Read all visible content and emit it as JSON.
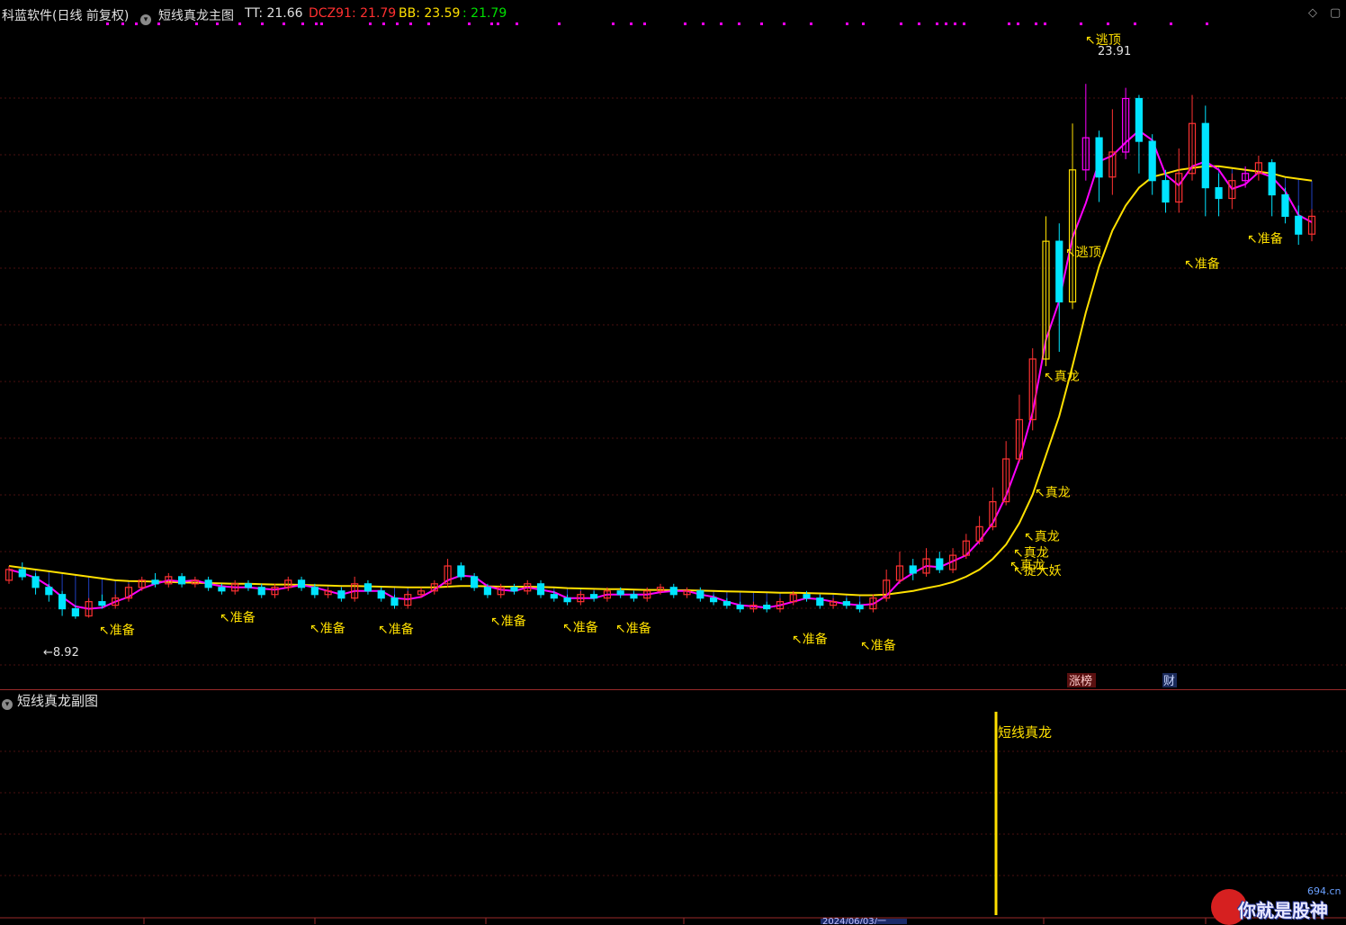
{
  "header": {
    "title": "科蓝软件(日线 前复权)",
    "indicator_name": "短线真龙主图",
    "tt_label": "TT: 21.66",
    "dcz_label": "DCZ91: 21.79",
    "bb_label": "BB: 23.59",
    "bb2_label": ": 21.79"
  },
  "colors": {
    "up": "#ff3232",
    "down": "#00e4ff",
    "dragon": "#ff00ff",
    "yellow_bar": "#ffe000",
    "ma_yellow": "#ffe000",
    "ma_magenta": "#ff00ff",
    "ma_green": "#00d000",
    "fill_blue": "#1f3fbf",
    "grid": "#4a1010"
  },
  "main_chart": {
    "high_label": "23.91",
    "low_label": "8.92",
    "annotations": [
      {
        "id": "zb1",
        "text": "准备"
      },
      {
        "id": "zb2",
        "text": "准备"
      },
      {
        "id": "zb3",
        "text": "准备"
      },
      {
        "id": "zb4",
        "text": "准备"
      },
      {
        "id": "zb5",
        "text": "准备"
      },
      {
        "id": "zb6",
        "text": "准备"
      },
      {
        "id": "zb7",
        "text": "准备"
      },
      {
        "id": "zb8",
        "text": "准备"
      },
      {
        "id": "zb9",
        "text": "准备"
      },
      {
        "id": "zl1",
        "text": "真龙"
      },
      {
        "id": "zl2",
        "text": "真龙"
      },
      {
        "id": "zl3",
        "text": "真龙"
      },
      {
        "id": "zl4",
        "text": "真龙"
      },
      {
        "id": "zl5",
        "text": "真龙"
      },
      {
        "id": "zy1",
        "text": "捉大妖"
      },
      {
        "id": "tp1",
        "text": "逃顶"
      },
      {
        "id": "tp2",
        "text": "逃顶"
      },
      {
        "id": "zb10",
        "text": "准备"
      },
      {
        "id": "zb11",
        "text": "准备"
      }
    ],
    "badges": {
      "zhangbang": "涨榜",
      "cai": "财"
    }
  },
  "sub_chart": {
    "title": "短线真龙副图",
    "signal_label": "短线真龙"
  },
  "time_axis": {
    "date_label": "2024/06/03/一"
  },
  "watermark": {
    "text": "你就是股神",
    "site": "694.cn"
  },
  "chart_data": {
    "type": "candlestick",
    "title": "科蓝软件(日线 前复权)",
    "ylim": [
      7.5,
      25
    ],
    "low": 8.92,
    "high": 23.91,
    "indicators": {
      "TT": 21.66,
      "DCZ91": 21.79,
      "BB": 23.59,
      "BB2": 21.79
    },
    "candles": [
      [
        10.0,
        10.3,
        10.4,
        9.9
      ],
      [
        10.3,
        10.1,
        10.5,
        10.0
      ],
      [
        10.1,
        9.8,
        10.2,
        9.6
      ],
      [
        9.8,
        9.6,
        9.9,
        9.4
      ],
      [
        9.6,
        9.2,
        9.7,
        9.0
      ],
      [
        9.2,
        9.0,
        9.3,
        8.92
      ],
      [
        9.0,
        9.4,
        9.5,
        8.95
      ],
      [
        9.4,
        9.3,
        9.6,
        9.2
      ],
      [
        9.3,
        9.5,
        9.6,
        9.2
      ],
      [
        9.5,
        9.8,
        9.9,
        9.4
      ],
      [
        9.8,
        10.0,
        10.1,
        9.7
      ],
      [
        10.0,
        9.9,
        10.2,
        9.8
      ],
      [
        9.9,
        10.1,
        10.2,
        9.8
      ],
      [
        10.1,
        9.9,
        10.2,
        9.8
      ],
      [
        9.9,
        10.0,
        10.1,
        9.8
      ],
      [
        10.0,
        9.8,
        10.1,
        9.7
      ],
      [
        9.8,
        9.7,
        9.9,
        9.6
      ],
      [
        9.7,
        9.9,
        10.0,
        9.6
      ],
      [
        9.9,
        9.8,
        10.0,
        9.7
      ],
      [
        9.8,
        9.6,
        9.9,
        9.5
      ],
      [
        9.6,
        9.8,
        9.9,
        9.5
      ],
      [
        9.8,
        10.0,
        10.1,
        9.7
      ],
      [
        10.0,
        9.8,
        10.1,
        9.7
      ],
      [
        9.8,
        9.6,
        9.9,
        9.5
      ],
      [
        9.6,
        9.7,
        9.8,
        9.5
      ],
      [
        9.7,
        9.5,
        9.8,
        9.4
      ],
      [
        9.5,
        9.9,
        10.1,
        9.4
      ],
      [
        9.9,
        9.7,
        10.0,
        9.6
      ],
      [
        9.7,
        9.5,
        9.8,
        9.4
      ],
      [
        9.5,
        9.3,
        9.6,
        9.2
      ],
      [
        9.3,
        9.6,
        9.7,
        9.2
      ],
      [
        9.6,
        9.7,
        9.8,
        9.5
      ],
      [
        9.7,
        9.9,
        10.0,
        9.6
      ],
      [
        9.9,
        10.4,
        10.6,
        9.8
      ],
      [
        10.4,
        10.1,
        10.5,
        10.0
      ],
      [
        10.1,
        9.8,
        10.2,
        9.7
      ],
      [
        9.8,
        9.6,
        9.9,
        9.5
      ],
      [
        9.6,
        9.8,
        9.9,
        9.5
      ],
      [
        9.8,
        9.7,
        9.9,
        9.6
      ],
      [
        9.7,
        9.9,
        10.0,
        9.6
      ],
      [
        9.9,
        9.6,
        10.0,
        9.5
      ],
      [
        9.6,
        9.5,
        9.7,
        9.4
      ],
      [
        9.5,
        9.4,
        9.6,
        9.3
      ],
      [
        9.4,
        9.6,
        9.7,
        9.3
      ],
      [
        9.6,
        9.5,
        9.7,
        9.4
      ],
      [
        9.5,
        9.7,
        9.8,
        9.4
      ],
      [
        9.7,
        9.6,
        9.8,
        9.5
      ],
      [
        9.6,
        9.5,
        9.7,
        9.4
      ],
      [
        9.5,
        9.7,
        9.8,
        9.4
      ],
      [
        9.7,
        9.8,
        9.9,
        9.6
      ],
      [
        9.8,
        9.6,
        9.9,
        9.5
      ],
      [
        9.6,
        9.7,
        9.8,
        9.5
      ],
      [
        9.7,
        9.5,
        9.8,
        9.4
      ],
      [
        9.5,
        9.4,
        9.6,
        9.3
      ],
      [
        9.4,
        9.3,
        9.5,
        9.2
      ],
      [
        9.3,
        9.2,
        9.4,
        9.1
      ],
      [
        9.2,
        9.3,
        9.4,
        9.1
      ],
      [
        9.3,
        9.2,
        9.4,
        9.1
      ],
      [
        9.2,
        9.4,
        9.5,
        9.1
      ],
      [
        9.4,
        9.6,
        9.7,
        9.3
      ],
      [
        9.6,
        9.5,
        9.7,
        9.4
      ],
      [
        9.5,
        9.3,
        9.6,
        9.2
      ],
      [
        9.3,
        9.4,
        9.5,
        9.2
      ],
      [
        9.4,
        9.3,
        9.5,
        9.2
      ],
      [
        9.3,
        9.2,
        9.4,
        9.1
      ],
      [
        9.2,
        9.5,
        9.6,
        9.1
      ],
      [
        9.5,
        10.0,
        10.3,
        9.4
      ],
      [
        10.0,
        10.4,
        10.8,
        9.9
      ],
      [
        10.4,
        10.2,
        10.6,
        10.0
      ],
      [
        10.2,
        10.6,
        10.9,
        10.1
      ],
      [
        10.6,
        10.3,
        10.8,
        10.2
      ],
      [
        10.3,
        10.7,
        10.9,
        10.2
      ],
      [
        10.7,
        11.1,
        11.3,
        10.6
      ],
      [
        11.1,
        11.5,
        11.8,
        11.0
      ],
      [
        11.5,
        12.2,
        12.6,
        11.4
      ],
      [
        12.2,
        13.4,
        13.9,
        12.1
      ],
      [
        13.4,
        14.5,
        15.2,
        13.3
      ],
      [
        14.5,
        16.2,
        16.5,
        14.2
      ],
      [
        16.2,
        19.5,
        20.2,
        16.0
      ],
      [
        19.5,
        17.8,
        20.0,
        16.4
      ],
      [
        17.8,
        21.5,
        22.8,
        17.6
      ],
      [
        21.5,
        22.4,
        23.91,
        21.2
      ],
      [
        22.4,
        21.3,
        22.6,
        20.6
      ],
      [
        21.3,
        22.0,
        23.2,
        20.8
      ],
      [
        22.0,
        23.5,
        23.8,
        21.8
      ],
      [
        23.5,
        22.3,
        23.6,
        21.4
      ],
      [
        22.3,
        21.2,
        22.5,
        20.8
      ],
      [
        21.2,
        20.6,
        21.5,
        20.3
      ],
      [
        20.6,
        21.4,
        22.1,
        20.3
      ],
      [
        21.4,
        22.8,
        23.6,
        21.2
      ],
      [
        22.8,
        21.0,
        23.3,
        20.2
      ],
      [
        21.0,
        20.7,
        21.4,
        20.2
      ],
      [
        20.7,
        21.2,
        21.4,
        20.4
      ],
      [
        21.2,
        21.4,
        21.6,
        21.0
      ],
      [
        21.4,
        21.7,
        21.9,
        21.2
      ],
      [
        21.7,
        20.8,
        21.8,
        20.2
      ],
      [
        20.8,
        20.2,
        21.0,
        20.0
      ],
      [
        20.2,
        19.7,
        20.5,
        19.4
      ],
      [
        19.7,
        20.2,
        20.4,
        19.5
      ]
    ],
    "ma_main": [
      10.4,
      10.35,
      10.3,
      10.25,
      10.2,
      10.15,
      10.1,
      10.05,
      10.0,
      9.98,
      9.97,
      9.96,
      9.95,
      9.94,
      9.93,
      9.92,
      9.91,
      9.9,
      9.9,
      9.89,
      9.88,
      9.88,
      9.87,
      9.86,
      9.85,
      9.84,
      9.84,
      9.83,
      9.82,
      9.81,
      9.8,
      9.8,
      9.8,
      9.82,
      9.84,
      9.84,
      9.83,
      9.82,
      9.82,
      9.82,
      9.81,
      9.8,
      9.78,
      9.77,
      9.76,
      9.75,
      9.75,
      9.74,
      9.73,
      9.73,
      9.72,
      9.72,
      9.71,
      9.7,
      9.69,
      9.68,
      9.67,
      9.66,
      9.65,
      9.65,
      9.64,
      9.63,
      9.62,
      9.6,
      9.58,
      9.58,
      9.6,
      9.65,
      9.7,
      9.78,
      9.85,
      9.95,
      10.1,
      10.3,
      10.6,
      11.0,
      11.6,
      12.4,
      13.5,
      14.6,
      16.0,
      17.5,
      18.8,
      19.8,
      20.5,
      21.0,
      21.3,
      21.4,
      21.5,
      21.55,
      21.6,
      21.6,
      21.55,
      21.5,
      21.45,
      21.4,
      21.3,
      21.25,
      21.2
    ],
    "signals": [
      {
        "x": 77,
        "value": 1,
        "label": "短线真龙"
      }
    ]
  }
}
